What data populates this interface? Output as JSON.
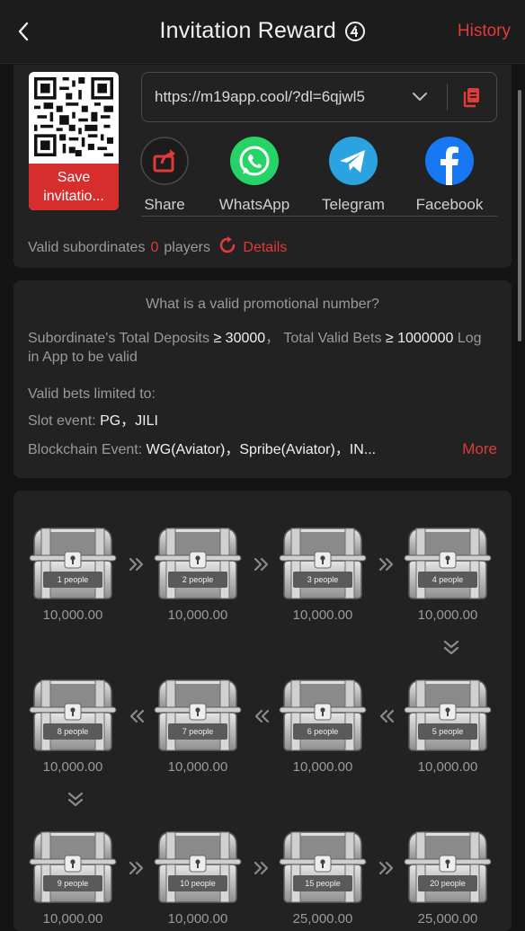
{
  "header": {
    "title": "Invitation Reward",
    "history_label": "History",
    "back_icon": "chevron-left-icon",
    "help_icon": "help-circle-icon"
  },
  "invite": {
    "save_label_line1": "Save",
    "save_label_line2": "invitatio...",
    "link": "https://m19app.cool/?dl=6qjwl5",
    "share_items": [
      {
        "label": "Share",
        "icon": "share-icon"
      },
      {
        "label": "WhatsApp",
        "icon": "whatsapp-icon"
      },
      {
        "label": "Telegram",
        "icon": "telegram-icon"
      },
      {
        "label": "Facebook",
        "icon": "facebook-icon"
      }
    ],
    "valid_label": "Valid subordinates",
    "valid_count": "0",
    "valid_unit": "players",
    "details_label": "Details"
  },
  "rules": {
    "title": "What is a valid promotional number?",
    "deposit_label": "Subordinate's Total Deposits",
    "deposit_value": "≥ 30000",
    "bets_label": "Total Valid Bets",
    "bets_value": "≥ 1000000",
    "login_text": "Log in App to be valid",
    "limited_label": "Valid bets limited to:",
    "slot_label": "Slot event:",
    "slot_value": "PG，JILI",
    "chain_label": "Blockchain Event:",
    "chain_value": "WG(Aviator)，Spribe(Aviator)，IN...",
    "more_label": "More"
  },
  "chests": [
    {
      "people": "1 people",
      "reward": "10,000.00"
    },
    {
      "people": "2 people",
      "reward": "10,000.00"
    },
    {
      "people": "3 people",
      "reward": "10,000.00"
    },
    {
      "people": "4 people",
      "reward": "10,000.00"
    },
    {
      "people": "5 people",
      "reward": "10,000.00"
    },
    {
      "people": "6 people",
      "reward": "10,000.00"
    },
    {
      "people": "7 people",
      "reward": "10,000.00"
    },
    {
      "people": "8 people",
      "reward": "10,000.00"
    },
    {
      "people": "9 people",
      "reward": "10,000.00"
    },
    {
      "people": "10 people",
      "reward": "10,000.00"
    },
    {
      "people": "15 people",
      "reward": "25,000.00"
    },
    {
      "people": "20 people",
      "reward": "25,000.00"
    }
  ],
  "colors": {
    "accent": "#e03a3a",
    "background": "#141414",
    "card": "#222222"
  }
}
